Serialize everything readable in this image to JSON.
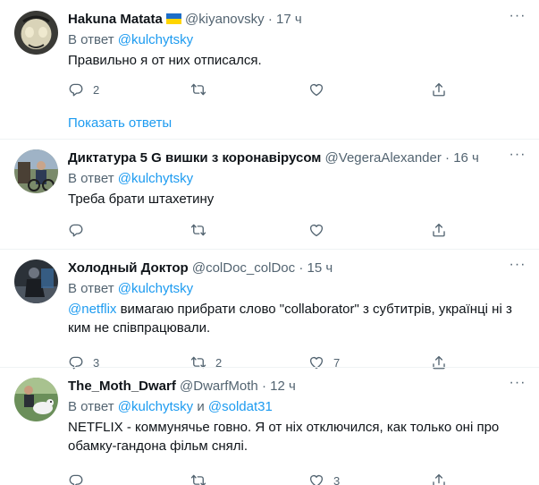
{
  "replying_prefix": "В ответ",
  "show_replies": "Показать ответы",
  "tweets": [
    {
      "name": "Hakuna Matata",
      "handle": "@kiyanovsky",
      "dot": "·",
      "time": "17 ч",
      "reply_to": "@kulchytsky",
      "text": "Правильно я от них отписался.",
      "replies": "2",
      "retweets": "",
      "likes": "",
      "flag": "ukraine-flag-icon"
    },
    {
      "name": "Диктатура 5 G вишки з коронавірусом",
      "handle": "@VegeraAlexander",
      "dot": "·",
      "time": "16 ч",
      "reply_to": "@kulchytsky",
      "text": "Треба брати штахетину",
      "replies": "",
      "retweets": "",
      "likes": ""
    },
    {
      "name": "Холодный Доктор",
      "handle": "@colDoc_colDoc",
      "dot": "·",
      "time": "15 ч",
      "reply_to": "@kulchytsky",
      "mention": "@netflix",
      "text": " вимагаю прибрати слово \"collaborator\" з субтитрів, українці ні з ким не співпрацювали.",
      "replies": "3",
      "retweets": "2",
      "likes": "7"
    },
    {
      "name": "The_Moth_Dwarf",
      "handle": "@DwarfMoth",
      "dot": "·",
      "time": "12 ч",
      "reply_to": "@kulchytsky",
      "reply_to_joiner": " и ",
      "reply_to_2": "@soldat31",
      "text": "NETFLIX - коммунячье говно. Я от ніх отключился, как только оні про обамку-гандона фільм снялі.",
      "replies": "",
      "retweets": "",
      "likes": "3"
    }
  ],
  "colors": {
    "link": "#1d9bf0",
    "secondary_text": "#536471",
    "primary_text": "#0f1419",
    "divider": "#eff3f4"
  }
}
